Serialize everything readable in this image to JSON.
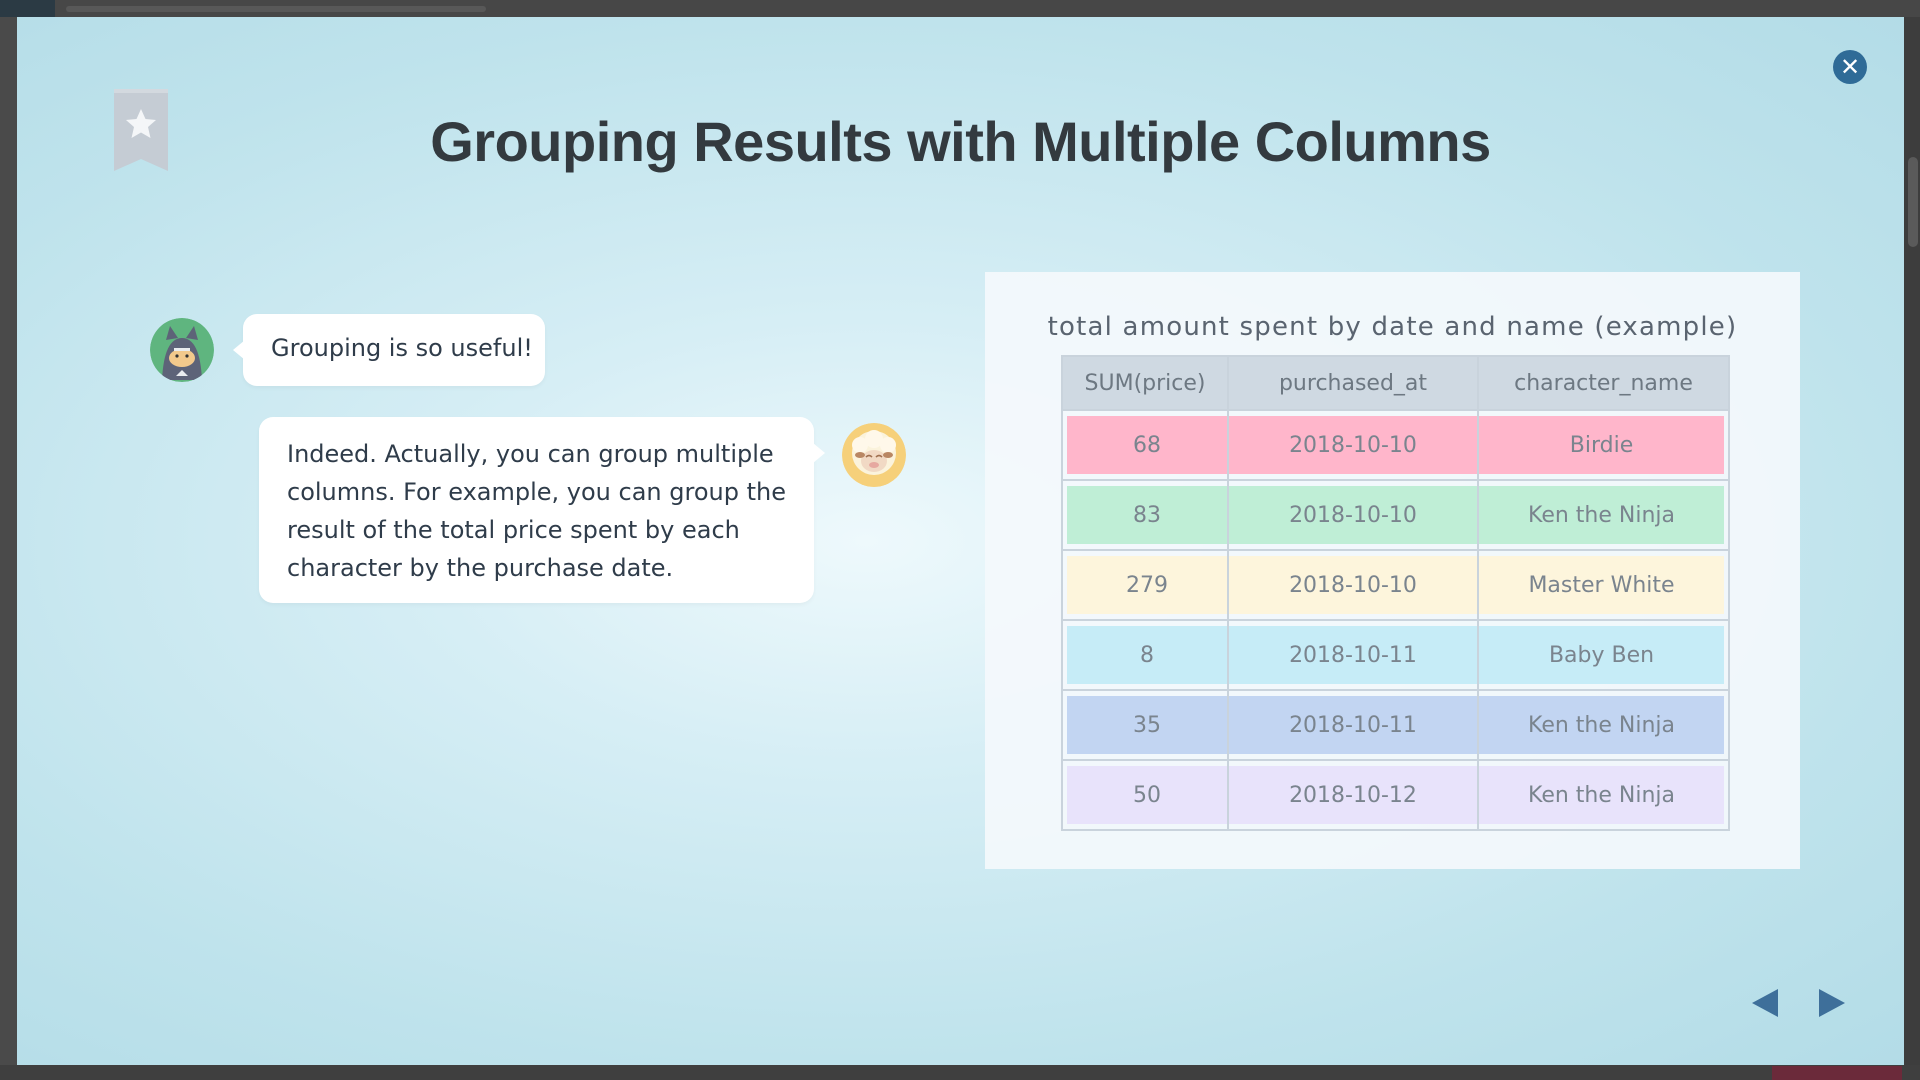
{
  "modal": {
    "title": "Grouping Results with Multiple Columns",
    "close_icon": "close-icon",
    "bookmark_icon": "bookmark-star-icon"
  },
  "dialogue": [
    {
      "speaker_icon": "ninja-cat-avatar",
      "text": "Grouping is so useful!"
    },
    {
      "speaker_icon": "sheep-avatar",
      "text": "Indeed. Actually, you can group multiple columns. For example, you can group the result of the total price spent by each character by the purchase date."
    }
  ],
  "table": {
    "caption": "total amount spent by date and name (example)",
    "headers": [
      "SUM(price)",
      "purchased_at",
      "character_name"
    ],
    "rows": [
      {
        "sum": "68",
        "date": "2018-10-10",
        "name": "Birdie",
        "color": "#ffb6cb"
      },
      {
        "sum": "83",
        "date": "2018-10-10",
        "name": "Ken the Ninja",
        "color": "#bfeed6"
      },
      {
        "sum": "279",
        "date": "2018-10-10",
        "name": "Master White",
        "color": "#fdf5dc"
      },
      {
        "sum": "8",
        "date": "2018-10-11",
        "name": "Baby Ben",
        "color": "#c6ecf7"
      },
      {
        "sum": "35",
        "date": "2018-10-11",
        "name": "Ken the Ninja",
        "color": "#c2d5f2"
      },
      {
        "sum": "50",
        "date": "2018-10-12",
        "name": "Ken the Ninja",
        "color": "#e8e3fb"
      }
    ]
  },
  "navigation": {
    "prev_icon": "triangle-left-icon",
    "next_icon": "triangle-right-icon",
    "accent": "#2f6b97"
  }
}
